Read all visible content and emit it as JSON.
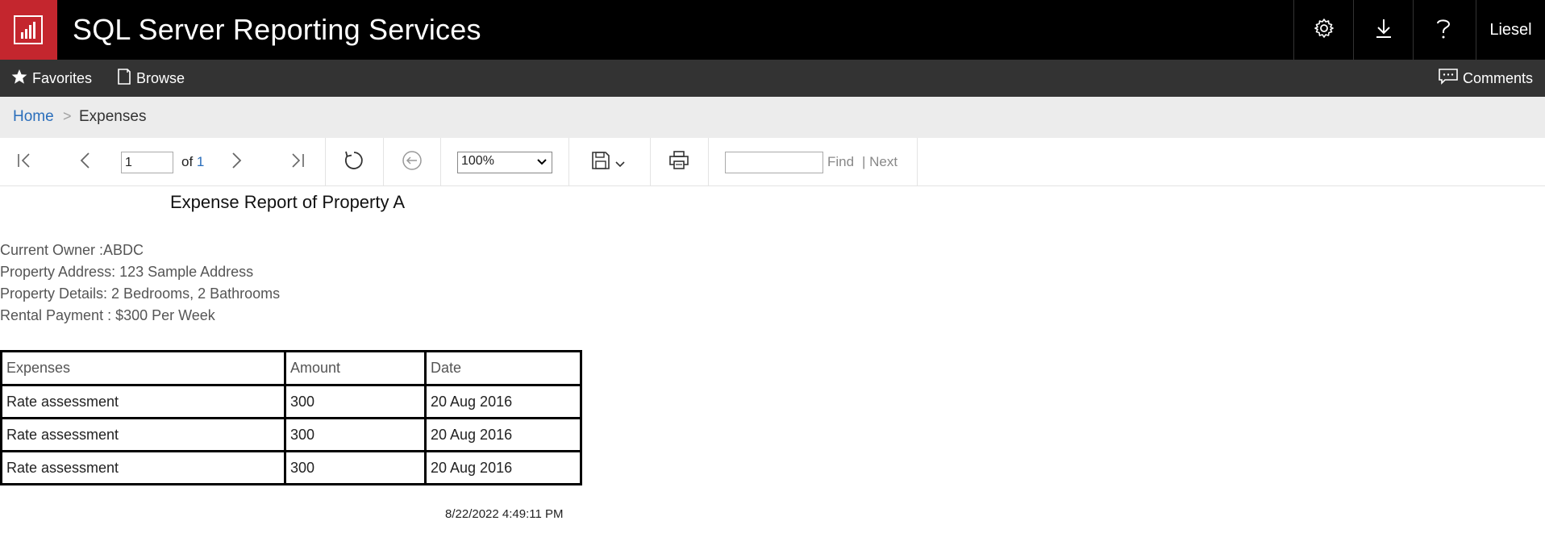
{
  "app": {
    "title": "SQL Server Reporting Services",
    "user": "Liesel"
  },
  "header": {
    "icons": [
      "settings-gear-icon",
      "download-icon",
      "help-icon"
    ]
  },
  "nav": {
    "favorites_label": "Favorites",
    "browse_label": "Browse",
    "comments_label": "Comments"
  },
  "breadcrumb": {
    "home": "Home",
    "separator": ">",
    "current": "Expenses"
  },
  "toolbar": {
    "page_value": "1",
    "page_of": "of",
    "page_total": "1",
    "zoom": "100%",
    "find_value": "",
    "find_label": "Find",
    "next_label": "| Next"
  },
  "report": {
    "title": "Expense Report of Property A",
    "info": [
      "Current Owner :ABDC",
      "Property Address: 123 Sample Address",
      "Property Details: 2 Bedrooms, 2 Bathrooms",
      "Rental Payment : $300 Per Week"
    ],
    "table": {
      "headers": [
        "Expenses",
        "Amount",
        "Date"
      ],
      "rows": [
        [
          "Rate assessment",
          "300",
          "20 Aug 2016"
        ],
        [
          "Rate assessment",
          "300",
          "20 Aug 2016"
        ],
        [
          "Rate assessment",
          "300",
          "20 Aug 2016"
        ]
      ]
    },
    "timestamp": "8/22/2022 4:49:11 PM"
  },
  "colors": {
    "brand": "#c4262e",
    "link": "#2a6ebb",
    "topbar": "#000000",
    "navbar": "#333333"
  }
}
